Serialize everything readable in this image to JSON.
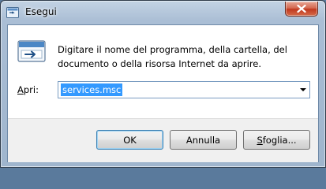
{
  "window": {
    "title": "Esegui",
    "close_icon": "close-icon",
    "app_icon": "run-icon"
  },
  "dialog": {
    "description_line1": "Digitare il nome del programma, della cartella, del",
    "description_line2": "documento o della risorsa Internet da aprire.",
    "open_label_accel": "A",
    "open_label_rest": "pri:",
    "open_value": "services.msc"
  },
  "buttons": {
    "ok": "OK",
    "cancel": "Annulla",
    "browse_accel": "S",
    "browse_rest": "foglia..."
  },
  "colors": {
    "selection": "#3399ff",
    "close_button": "#c0391f",
    "footer": "#f0f0f0"
  }
}
